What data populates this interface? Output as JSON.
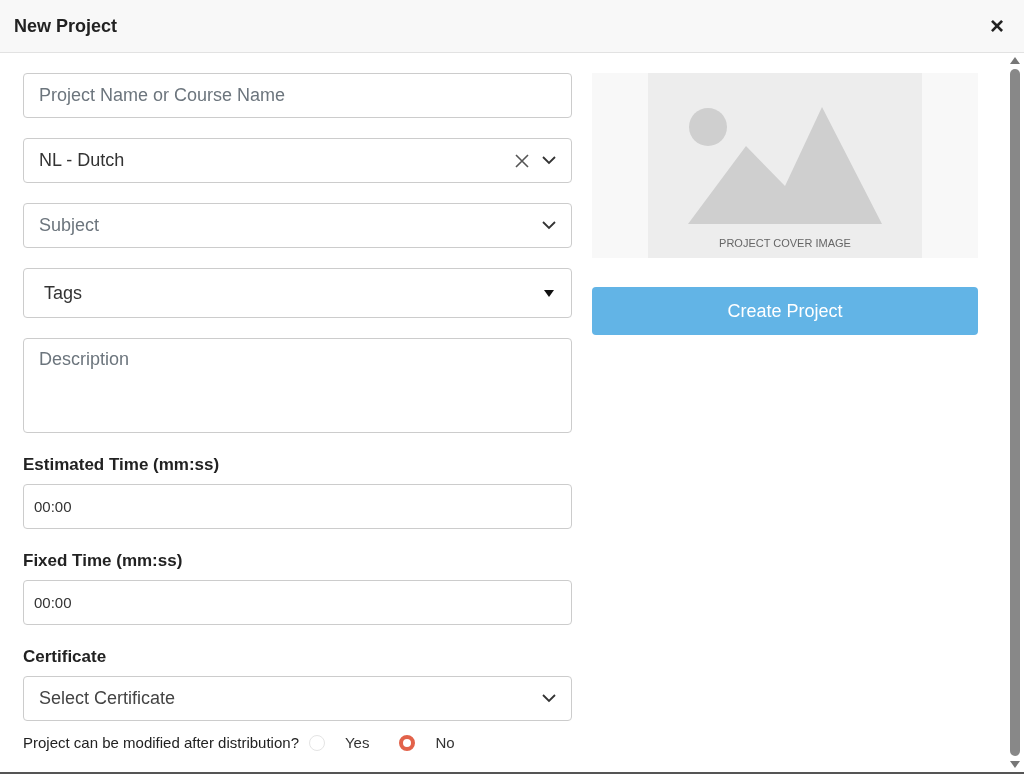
{
  "window": {
    "title": "New Project",
    "close": "×"
  },
  "fields": [
    {
      "kind": "input",
      "placeholder": "Project Name or Course Name"
    },
    {
      "kind": "select",
      "value": "NL - Dutch",
      "clearable": true
    },
    {
      "kind": "select",
      "placeholder": "Subject",
      "clearable": false
    },
    {
      "kind": "tags",
      "placeholder": "Tags"
    },
    {
      "kind": "textarea",
      "placeholder": "Description"
    },
    {
      "kind": "labeled",
      "label": "Estimated Time (mm:ss)",
      "value": "00:00"
    },
    {
      "kind": "labeled",
      "label": "Fixed Time (mm:ss)",
      "value": "00:00"
    },
    {
      "kind": "labeled-select",
      "label": "Certificate",
      "placeholder": "Select Certificate"
    }
  ],
  "question": {
    "text": "Project can be modified after distribution?",
    "options": [
      {
        "label": "Yes",
        "selected": false
      },
      {
        "label": "No",
        "selected": true
      }
    ]
  },
  "cover": {
    "caption": "PROJECT COVER IMAGE"
  },
  "create_button": "Create Project"
}
